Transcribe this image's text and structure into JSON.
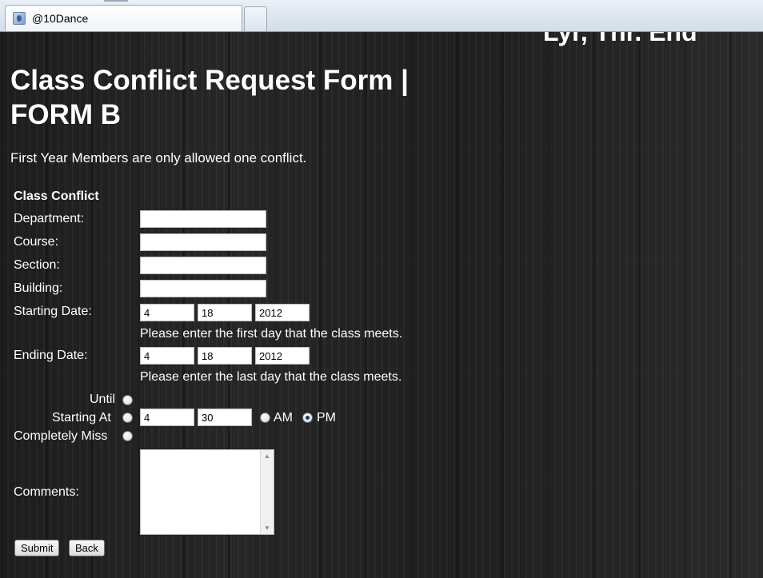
{
  "browser": {
    "tab_title": "@10Dance"
  },
  "page": {
    "corner_text": "Lyr, Thr. End",
    "title": "Class Conflict Request Form | FORM B",
    "intro": "First Year Members are only allowed one conflict.",
    "section_heading": "Class Conflict",
    "labels": {
      "department": "Department:",
      "course": "Course:",
      "section": "Section:",
      "building": "Building:",
      "starting_date": "Starting Date:",
      "ending_date": "Ending Date:",
      "until": "Until",
      "starting_at": "Starting At",
      "completely_miss": "Completely Miss",
      "comments": "Comments:"
    },
    "fields": {
      "department": "",
      "course": "",
      "section": "",
      "building": "",
      "start_month": "4",
      "start_day": "18",
      "start_year": "2012",
      "end_month": "4",
      "end_day": "18",
      "end_year": "2012",
      "time_hour": "4",
      "time_minute": "30",
      "comments": ""
    },
    "hints": {
      "start": "Please enter the first day that the class meets.",
      "end": "Please enter the last day that the class meets."
    },
    "ampm": {
      "am_label": "AM",
      "pm_label": "PM",
      "selected": "PM"
    },
    "buttons": {
      "submit": "Submit",
      "back": "Back"
    }
  }
}
